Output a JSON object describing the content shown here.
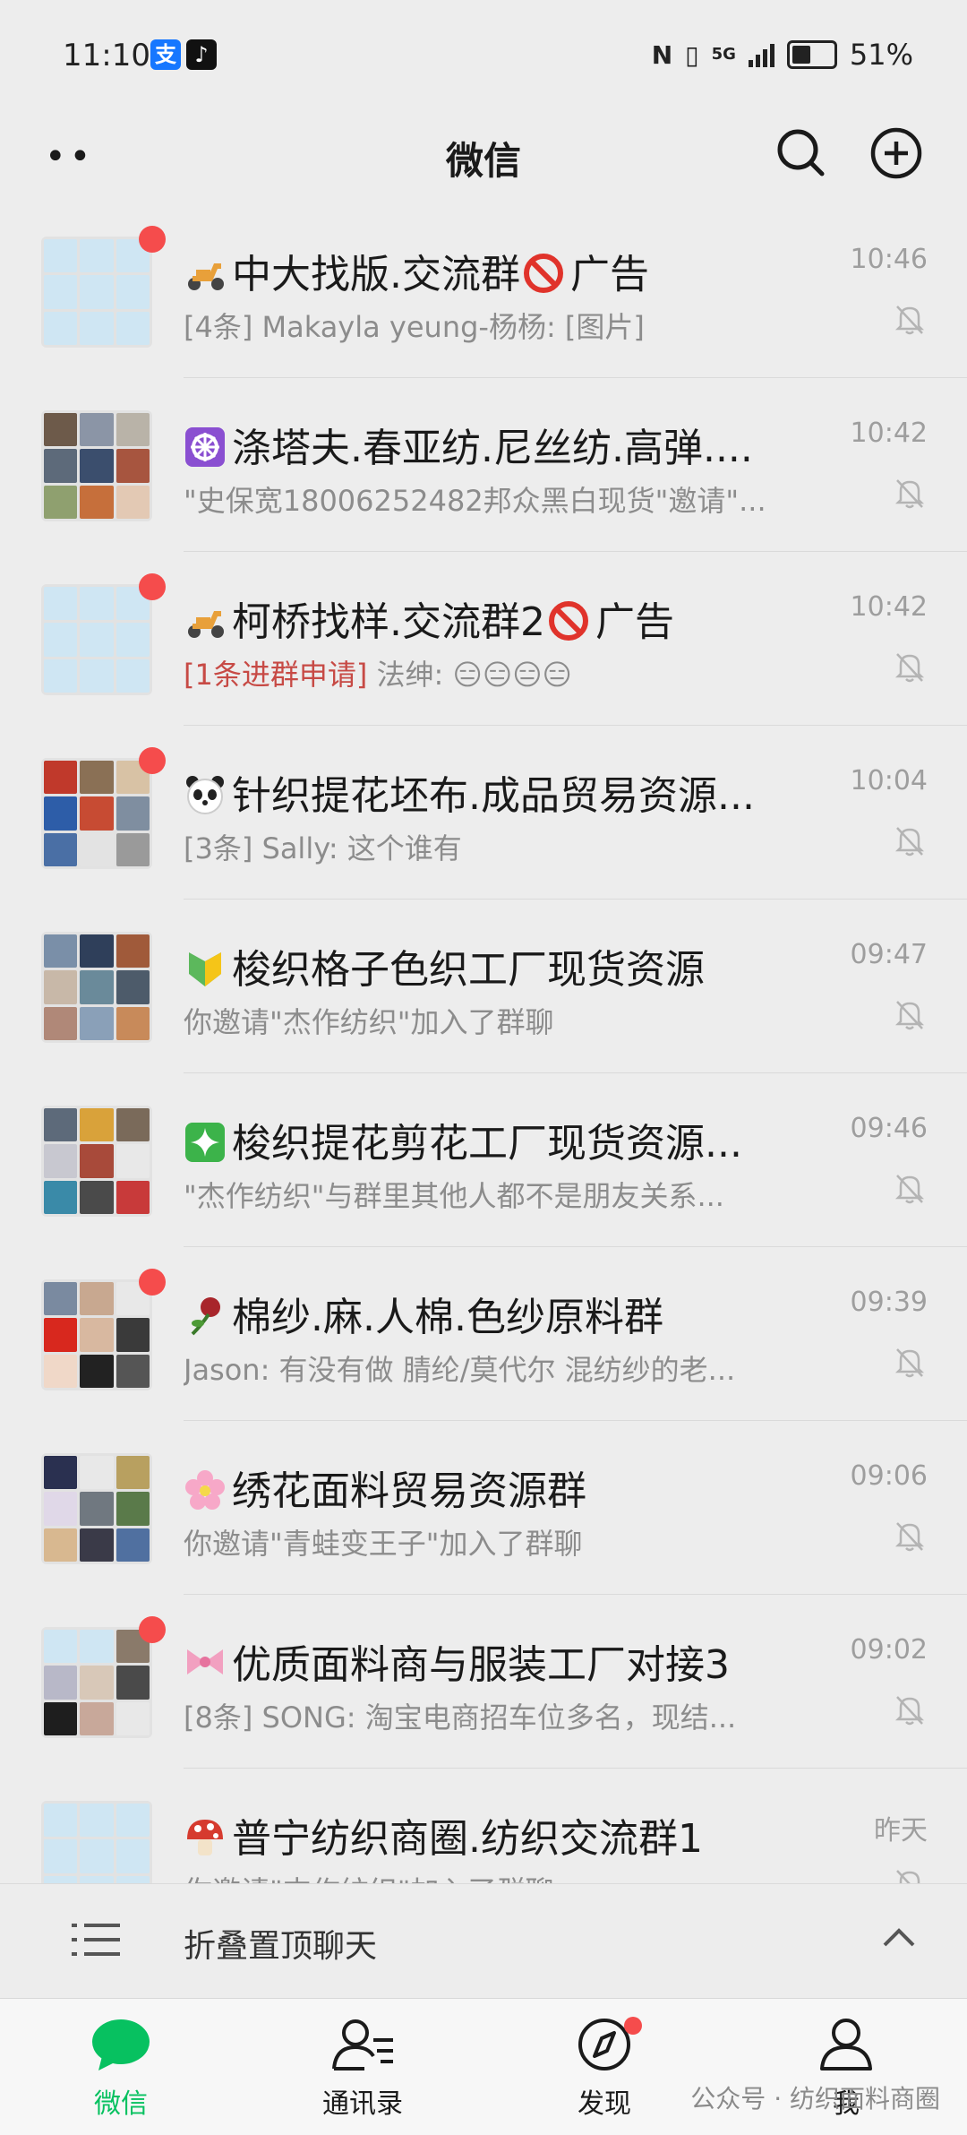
{
  "status_bar": {
    "time": "11:10",
    "battery": "51%",
    "battery_level": 0.51,
    "network": "5G"
  },
  "header": {
    "title": "微信"
  },
  "chats": [
    {
      "name": "中大找版.交流群",
      "suffix": "广告",
      "emoji": "scooter",
      "ban": true,
      "time": "10:46",
      "preview_tag": "",
      "preview": "[4条] Makayla yeung-杨杨: [图片]",
      "unread": true,
      "avatar": "tiles-blue"
    },
    {
      "name": "涤塔夫.春亚纺.尼丝纺.高弹....",
      "suffix": "",
      "emoji": "wheel",
      "ban": false,
      "time": "10:42",
      "preview_tag": "",
      "preview": "\"史保宽18006252482邦众黑白现货\"邀请\"...",
      "unread": false,
      "avatar": "photos-a"
    },
    {
      "name": "柯桥找样.交流群2",
      "suffix": "广告",
      "emoji": "scooter",
      "ban": true,
      "time": "10:42",
      "preview_tag": "[1条进群申请]",
      "preview": " 法绅: 😑😑😑😑",
      "unread": true,
      "avatar": "tiles-blue"
    },
    {
      "name": "针织提花坯布.成品贸易资源...",
      "suffix": "",
      "emoji": "panda",
      "ban": false,
      "time": "10:04",
      "preview_tag": "",
      "preview": "[3条] Sally: 这个谁有",
      "unread": true,
      "avatar": "photos-b"
    },
    {
      "name": "梭织格子色织工厂现货资源",
      "suffix": "",
      "emoji": "leaf-badge",
      "ban": false,
      "time": "09:47",
      "preview_tag": "",
      "preview": "你邀请\"杰作纺织\"加入了群聊",
      "unread": false,
      "avatar": "photos-c"
    },
    {
      "name": "梭织提花剪花工厂现货资源...",
      "suffix": "",
      "emoji": "sparkle",
      "ban": false,
      "time": "09:46",
      "preview_tag": "",
      "preview": "\"杰作纺织\"与群里其他人都不是朋友关系...",
      "unread": false,
      "avatar": "photos-d"
    },
    {
      "name": "棉纱.麻.人棉.色纱原料群",
      "suffix": "",
      "emoji": "rose",
      "ban": false,
      "time": "09:39",
      "preview_tag": "",
      "preview": "Jason: 有没有做 腈纶/莫代尔 混纺纱的老...",
      "unread": true,
      "avatar": "photos-e"
    },
    {
      "name": "绣花面料贸易资源群",
      "suffix": "",
      "emoji": "blossom",
      "ban": false,
      "time": "09:06",
      "preview_tag": "",
      "preview": "你邀请\"青蛙变王子\"加入了群聊",
      "unread": false,
      "avatar": "photos-f"
    },
    {
      "name": "优质面料商与服装工厂对接3",
      "suffix": "",
      "emoji": "ribbon",
      "ban": false,
      "time": "09:02",
      "preview_tag": "",
      "preview": "[8条] SONG: 淘宝电商招车位多名，现结...",
      "unread": true,
      "avatar": "photos-g"
    },
    {
      "name": "普宁纺织商圈.纺织交流群1",
      "suffix": "",
      "emoji": "mushroom",
      "ban": false,
      "time": "昨天",
      "preview_tag": "",
      "preview": "你邀请\"杰作纺织\"加入了群聊",
      "unread": false,
      "avatar": "tiles-blue"
    }
  ],
  "fold_bar": {
    "label": "折叠置顶聊天"
  },
  "nav": [
    {
      "label": "微信",
      "icon": "chat-bubble-icon",
      "active": true,
      "badge": false
    },
    {
      "label": "通讯录",
      "icon": "contacts-icon",
      "active": false,
      "badge": false
    },
    {
      "label": "发现",
      "icon": "compass-icon",
      "active": false,
      "badge": true
    },
    {
      "label": "我",
      "icon": "person-icon",
      "active": false,
      "badge": false
    }
  ],
  "watermark": "公众号 · 纺织面料商圈",
  "colors": {
    "accent": "#07c160",
    "badge": "#f54c4c",
    "background": "#ededed"
  }
}
